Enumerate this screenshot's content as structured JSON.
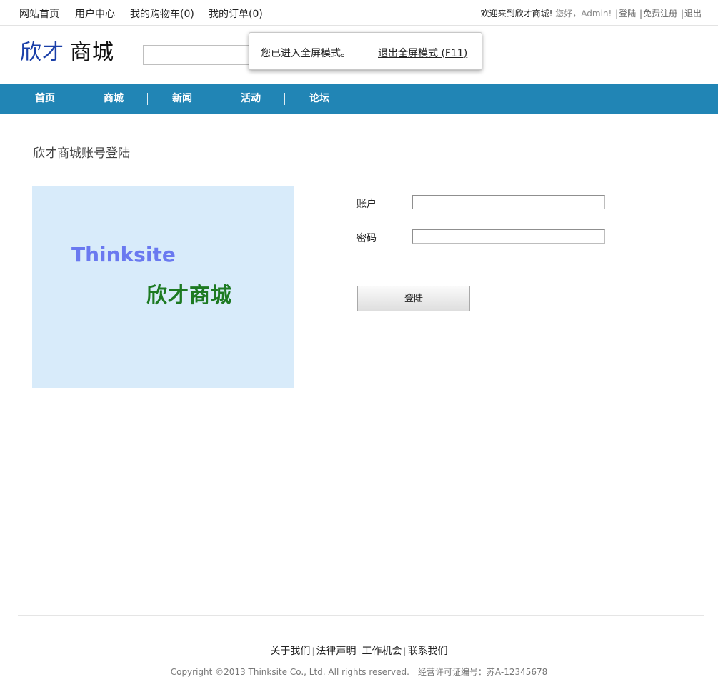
{
  "topbar": {
    "links": [
      "网站首页",
      "用户中心",
      "我的购物车(0)",
      "我的订单(0)"
    ],
    "welcome": "欢迎来到欣才商城!",
    "greeting": "您好，Admin!",
    "login": "登陆",
    "register": "免费注册",
    "logout": "退出",
    "separator": "|"
  },
  "logo": {
    "part1": "欣才",
    "part2": "商城"
  },
  "fullscreen_popup": {
    "message": "您已进入全屏模式。",
    "exit_link": "退出全屏模式 (F11)"
  },
  "nav": {
    "items": [
      "首页",
      "商城",
      "新闻",
      "活动",
      "论坛"
    ]
  },
  "page": {
    "title": "欣才商城账号登陆"
  },
  "banner": {
    "line1": "Thinksite",
    "line2": "欣才商城"
  },
  "form": {
    "account_label": "账户",
    "account_value": "",
    "password_label": "密码",
    "password_value": "",
    "submit_label": "登陆"
  },
  "footer": {
    "links": [
      "关于我们",
      "法律声明",
      "工作机会",
      "联系我们"
    ],
    "separator": "|",
    "copyright": "Copyright ©2013 Thinksite Co., Ltd. All rights reserved.",
    "license": "经营许可证编号：苏A-12345678"
  },
  "colors": {
    "nav_bg": "#2185b5",
    "logo_blue": "#1a3fa8",
    "banner_bg": "#d8ebfa",
    "banner_text1": "#6a79f0",
    "banner_text2": "#1d7a22"
  }
}
